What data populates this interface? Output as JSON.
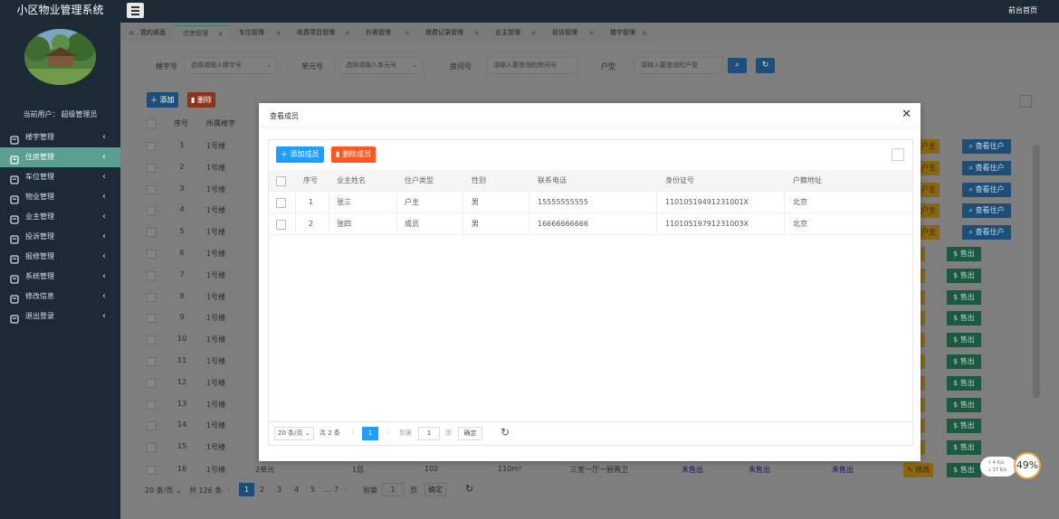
{
  "app": {
    "title": "小区物业管理系统",
    "home_link": "前台首页"
  },
  "sidebar": {
    "current_user_prefix": "当前用户：",
    "current_user_name": "超级管理员",
    "items": [
      {
        "label": "楼宇管理",
        "icon": "building-icon",
        "active": false
      },
      {
        "label": "住房管理",
        "icon": "house-icon",
        "active": true
      },
      {
        "label": "车位管理",
        "icon": "car-icon",
        "active": false
      },
      {
        "label": "物业管理",
        "icon": "gear-icon",
        "active": false
      },
      {
        "label": "业主管理",
        "icon": "user-icon",
        "active": false
      },
      {
        "label": "投诉管理",
        "icon": "complaint-icon",
        "active": false
      },
      {
        "label": "报修管理",
        "icon": "repair-icon",
        "active": false
      },
      {
        "label": "系统管理",
        "icon": "system-icon",
        "active": false
      },
      {
        "label": "修改信息",
        "icon": "lock-icon",
        "active": false
      },
      {
        "label": "退出登录",
        "icon": "logout-icon",
        "active": false
      }
    ]
  },
  "tabs": [
    {
      "label": "我的桌面",
      "home": true
    },
    {
      "label": "住房管理",
      "active": true
    },
    {
      "label": "车位管理"
    },
    {
      "label": "收费项目管理"
    },
    {
      "label": "抄表管理"
    },
    {
      "label": "缴费记录管理"
    },
    {
      "label": "业主管理"
    },
    {
      "label": "投诉管理"
    },
    {
      "label": "楼宇管理"
    }
  ],
  "search": {
    "building_label": "楼宇号",
    "building_placeholder": "选择或输入楼宇号",
    "unit_label": "单元号",
    "unit_placeholder": "选择或输入单元号",
    "room_label": "房间号",
    "room_placeholder": "请输入要查询的房间号",
    "type_label": "户型",
    "type_placeholder": "请输入要查询的户型"
  },
  "actions": {
    "add": "添加",
    "delete": "删除"
  },
  "bg_table": {
    "headers": {
      "no": "序号",
      "building": "所属楼宇"
    },
    "rows": [
      {
        "no": "1",
        "building": "1号楼",
        "edit": "修改户主",
        "btn": "查看住户"
      },
      {
        "no": "2",
        "building": "1号楼",
        "edit": "修改户主",
        "btn": "查看住户"
      },
      {
        "no": "3",
        "building": "1号楼",
        "edit": "修改户主",
        "btn": "查看住户"
      },
      {
        "no": "4",
        "building": "1号楼",
        "edit": "修改户主",
        "btn": "查看住户"
      },
      {
        "no": "5",
        "building": "1号楼",
        "edit": "修改户主",
        "btn": "查看住户"
      },
      {
        "no": "6",
        "building": "1号楼",
        "edit": "修改",
        "btn": "售出"
      },
      {
        "no": "7",
        "building": "1号楼",
        "edit": "修改",
        "btn": "售出"
      },
      {
        "no": "8",
        "building": "1号楼",
        "edit": "修改",
        "btn": "售出"
      },
      {
        "no": "9",
        "building": "1号楼",
        "edit": "修改",
        "btn": "售出"
      },
      {
        "no": "10",
        "building": "1号楼",
        "edit": "修改",
        "btn": "售出"
      },
      {
        "no": "11",
        "building": "1号楼",
        "edit": "修改",
        "btn": "售出"
      },
      {
        "no": "12",
        "building": "1号楼",
        "edit": "修改",
        "btn": "售出"
      },
      {
        "no": "13",
        "building": "1号楼",
        "edit": "修改",
        "btn": "售出"
      },
      {
        "no": "14",
        "building": "1号楼",
        "edit": "修改",
        "btn": "售出"
      },
      {
        "no": "15",
        "building": "1号楼",
        "edit": "修改",
        "btn": "售出"
      }
    ],
    "last_row": {
      "no": "16",
      "building": "1号楼",
      "unit": "2单元",
      "floor": "1层",
      "room": "102",
      "area": "110m²",
      "layout": "三室一厅一厨两卫",
      "s1": "未售出",
      "s2": "未售出",
      "s3": "未售出",
      "edit": "修改",
      "btn": "售出"
    }
  },
  "bg_pagination": {
    "page_size": "20 条/页",
    "total": "共 126 条",
    "pages": [
      "1",
      "2",
      "3",
      "4",
      "5",
      "...",
      "7"
    ],
    "goto": "到第",
    "goto_value": "1",
    "page_unit": "页",
    "confirm": "确定"
  },
  "modal": {
    "title": "查看成员",
    "add_member": "添加成员",
    "delete_member": "删除成员",
    "headers": {
      "no": "序号",
      "name": "业主姓名",
      "type": "住户类型",
      "gender": "性别",
      "phone": "联系电话",
      "id": "身份证号",
      "address": "户籍地址"
    },
    "rows": [
      {
        "no": "1",
        "name": "张三",
        "type": "户主",
        "gender": "男",
        "phone": "15555555555",
        "id": "11010519491231001X",
        "address": "北京"
      },
      {
        "no": "2",
        "name": "张四",
        "type": "成员",
        "gender": "男",
        "phone": "16666666666",
        "id": "11010519791231003X",
        "address": "北京"
      }
    ],
    "pagination": {
      "page_size": "20 条/页",
      "total": "共 2 条",
      "current": "1",
      "goto": "到第",
      "goto_value": "1",
      "page_unit": "页",
      "confirm": "确定"
    }
  },
  "status": {
    "percent": "49%",
    "up": "↑ 4  K/s",
    "down": "↓ 17  K/s"
  }
}
